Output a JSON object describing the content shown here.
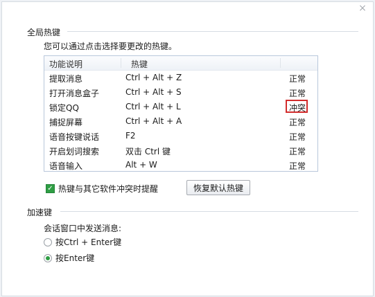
{
  "window": {
    "close_glyph": "×"
  },
  "global_hotkeys": {
    "title": "全局热键",
    "description": "您可以通过点击选择要更改的热键。",
    "columns": {
      "function": "功能说明",
      "hotkey": "热键"
    },
    "rows": [
      {
        "name": "提取消息",
        "key": "Ctrl + Alt + Z",
        "status": "正常"
      },
      {
        "name": "打开消息盒子",
        "key": "Ctrl + Alt + S",
        "status": "正常"
      },
      {
        "name": "锁定QQ",
        "key": "Ctrl + Alt + L",
        "status": "冲突"
      },
      {
        "name": "捕捉屏幕",
        "key": "Ctrl + Alt + A",
        "status": "正常"
      },
      {
        "name": "语音按键说话",
        "key": "F2",
        "status": "正常"
      },
      {
        "name": "开启划词搜索",
        "key": "双击 Ctrl 键",
        "status": "正常"
      },
      {
        "name": "语音输入",
        "key": "Alt + W",
        "status": "正常"
      }
    ],
    "conflict_checkbox": {
      "label": "热键与其它软件冲突时提醒",
      "checked": true
    },
    "restore_button": "恢复默认热键"
  },
  "accelerators": {
    "title": "加速键",
    "send_label": "会话窗口中发送消息:",
    "options": [
      {
        "label": "按Ctrl + Enter键",
        "selected": false
      },
      {
        "label": "按Enter键",
        "selected": true
      }
    ]
  },
  "colors": {
    "accent_green": "#2f9e44",
    "conflict_red": "#d22b2b",
    "table_border": "#b8c7db"
  }
}
